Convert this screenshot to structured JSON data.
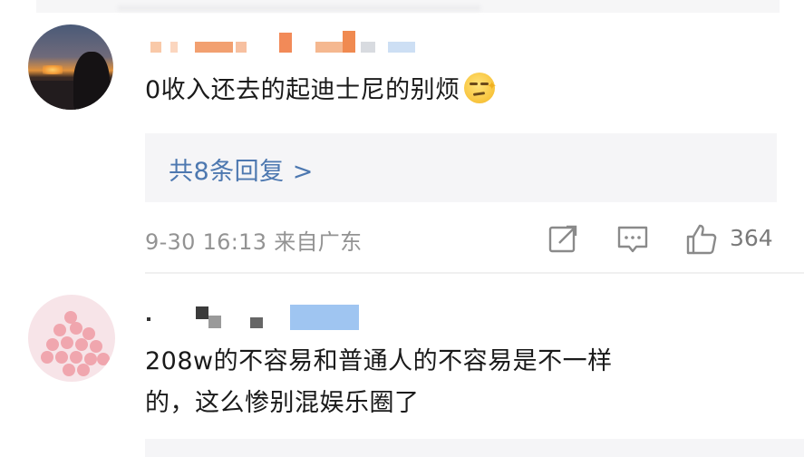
{
  "comments": [
    {
      "text": "0收入还去的起迪士尼的别烦",
      "emoji": "smirk-face-emoji",
      "replies_label": "共8条回复 >",
      "timestamp": "9-30 16:13",
      "location": "来自广东",
      "like_count": "364"
    },
    {
      "text_line1": "208w的不容易和普通人的不容易是不一样",
      "text_line2": "的，这么惨别混娱乐圈了"
    }
  ],
  "icons": {
    "share": "share-icon",
    "comment": "comment-icon",
    "like": "thumbs-up-icon"
  },
  "colors": {
    "reply_link": "#4d78b0",
    "meta_text": "#939393",
    "reply_bg": "#f5f5f7"
  }
}
